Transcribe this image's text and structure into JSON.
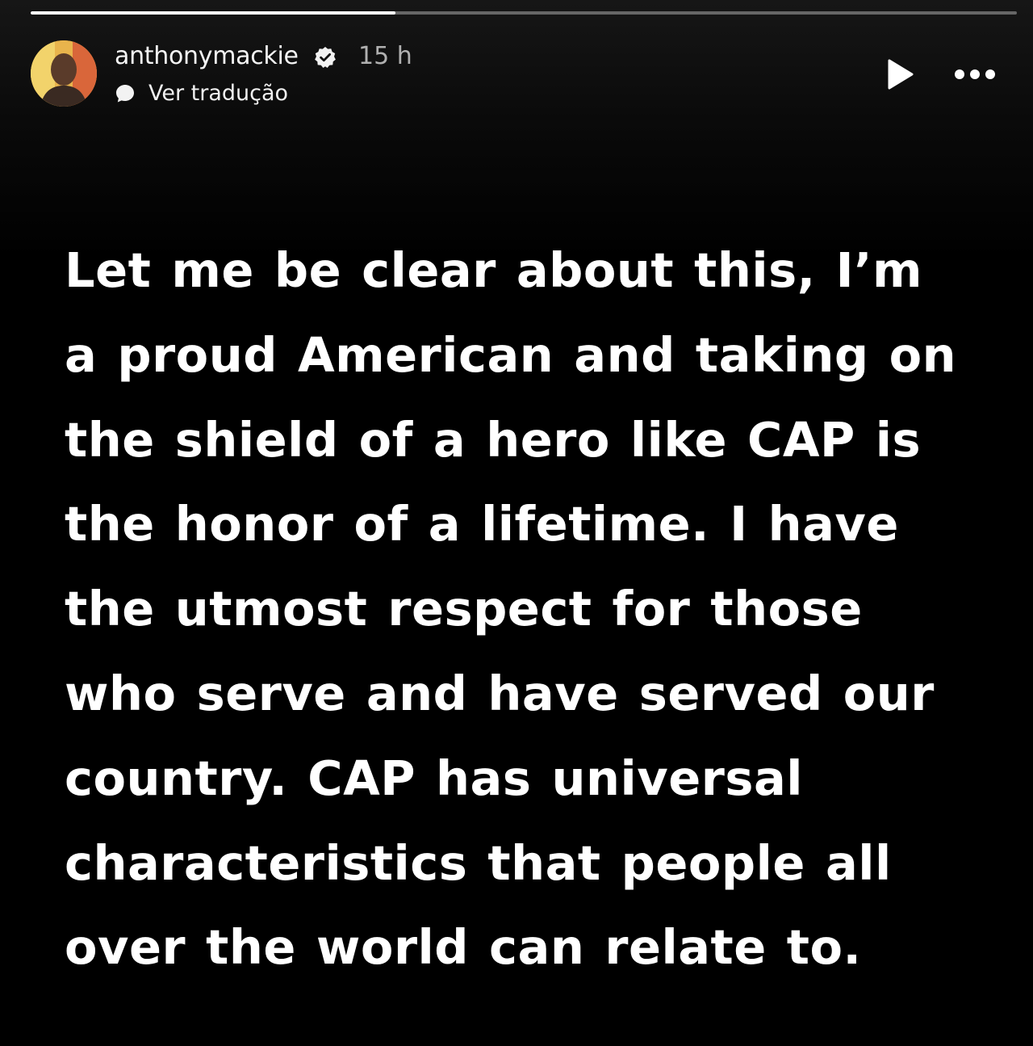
{
  "story": {
    "progress": 0.37,
    "progress_color": "#ffffff",
    "background_color": "#000000"
  },
  "header": {
    "username": "anthonymackie",
    "verified": true,
    "time": "15 h",
    "translate_label": "Ver tradução",
    "play_icon": "play-icon",
    "more_icon": "more-icon"
  },
  "content": {
    "lines": [
      "Let me be clear about this, I’m",
      "a proud American and taking on",
      "the shield of a hero like CAP is",
      "the honor of a lifetime. I have",
      "the utmost respect for those",
      "who serve and have served our",
      "country. CAP has universal",
      "characteristics that people all",
      "over the world can relate to."
    ]
  }
}
